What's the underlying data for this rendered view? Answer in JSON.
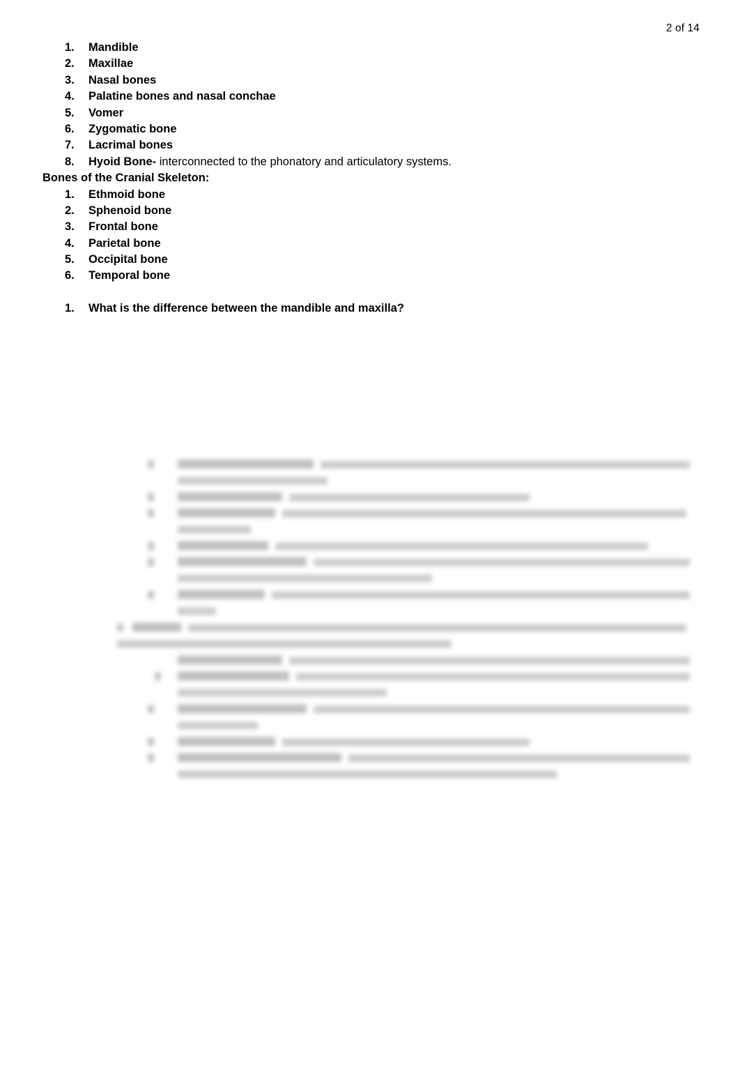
{
  "header": {
    "page_indicator": "2 of 14"
  },
  "facial_bones_list": [
    {
      "number": "1.",
      "text": "Mandible"
    },
    {
      "number": "2.",
      "text": "Maxillae"
    },
    {
      "number": "3.",
      "text": "Nasal bones"
    },
    {
      "number": "4.",
      "text": "Palatine bones and nasal conchae"
    },
    {
      "number": "5.",
      "text": "Vomer"
    },
    {
      "number": "6.",
      "text": "Zygomatic bone"
    },
    {
      "number": "7.",
      "text": "Lacrimal bones"
    },
    {
      "number": "8.",
      "bold_text": "Hyoid Bone-",
      "normal_text": " interconnected to the phonatory and articulatory  systems."
    }
  ],
  "cranial_heading": "Bones of the Cranial Skeleton:",
  "cranial_bones_list": [
    {
      "number": "1.",
      "text": "Ethmoid bone"
    },
    {
      "number": "2.",
      "text": "Sphenoid bone"
    },
    {
      "number": "3.",
      "text": "Frontal bone"
    },
    {
      "number": "4.",
      "text": "Parietal bone"
    },
    {
      "number": "5.",
      "text": "Occipital bone"
    },
    {
      "number": "6.",
      "text": "Temporal bone"
    }
  ],
  "question_list": [
    {
      "number": "1.",
      "text": "What is the difference between the mandible and maxilla?"
    }
  ],
  "obscured_region": {
    "description": "Blurred illegible list block of anatomical term definitions",
    "legible": false
  },
  "colors": {
    "page_background": "#ffffff",
    "text": "#000000",
    "blurred_text": "#c9c9c9"
  }
}
